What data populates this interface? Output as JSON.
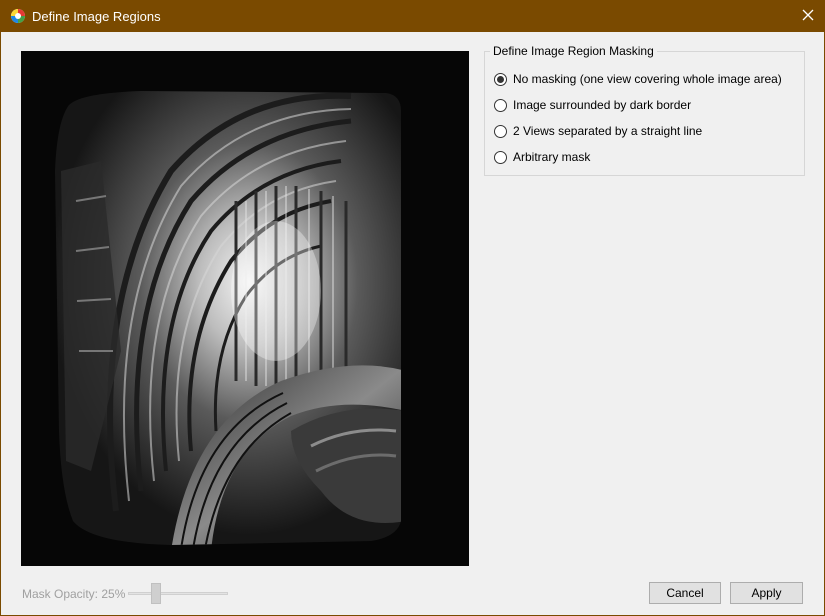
{
  "window": {
    "title": "Define Image Regions",
    "title_bar_color": "#7a4a00",
    "app_icon": "app-logo-icon",
    "close_icon": "close-icon"
  },
  "image_panel": {
    "content": "camera image (grayscale)"
  },
  "masking_group": {
    "legend": "Define Image Region Masking",
    "options": [
      {
        "label": "No masking (one view covering whole image area)",
        "checked": true
      },
      {
        "label": "Image surrounded by dark border",
        "checked": false
      },
      {
        "label": "2 Views separated by a straight line",
        "checked": false
      },
      {
        "label": "Arbitrary mask",
        "checked": false
      }
    ]
  },
  "footer": {
    "opacity_label": "Mask Opacity: 25%",
    "opacity_value": 0.25,
    "slider_enabled": false,
    "cancel_label": "Cancel",
    "apply_label": "Apply"
  }
}
